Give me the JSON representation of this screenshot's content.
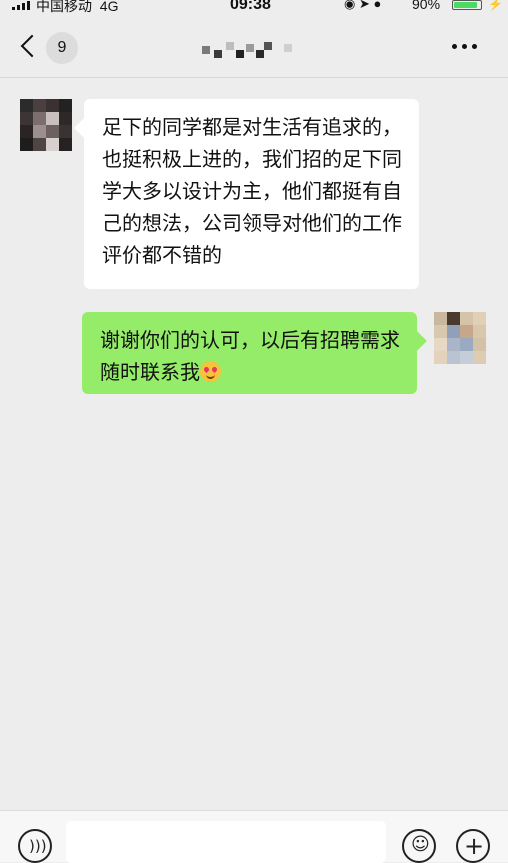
{
  "status_bar": {
    "carrier": "中国移动",
    "network": "4G",
    "time": "09:38",
    "battery": "90%",
    "battery_level": 0.9,
    "battery_color": "#4cd964"
  },
  "nav": {
    "back_icon": "chevron-left-icon",
    "unread_count": "9",
    "title": "",
    "more_icon": "ellipsis-icon"
  },
  "messages": [
    {
      "direction": "incoming",
      "text": "足下的同学都是对生活有追求的，也挺积极上进的，我们招的足下同学大多以设计为主，他们都挺有自己的想法，公司领导对他们的工作评价都不错的",
      "bubble_color": "#ffffff"
    },
    {
      "direction": "outgoing",
      "text": "谢谢你们的认可，以后有招聘需求随时联系我",
      "emoji": "smiling-face-with-heart-eyes",
      "bubble_color": "#95ec69"
    }
  ],
  "input_bar": {
    "voice_icon": "voice-icon",
    "emoji_icon": "emoji-icon",
    "plus_icon": "plus-icon",
    "text": ""
  },
  "colors": {
    "background": "#ededed",
    "outgoing_bubble": "#95ec69",
    "incoming_bubble": "#ffffff"
  }
}
